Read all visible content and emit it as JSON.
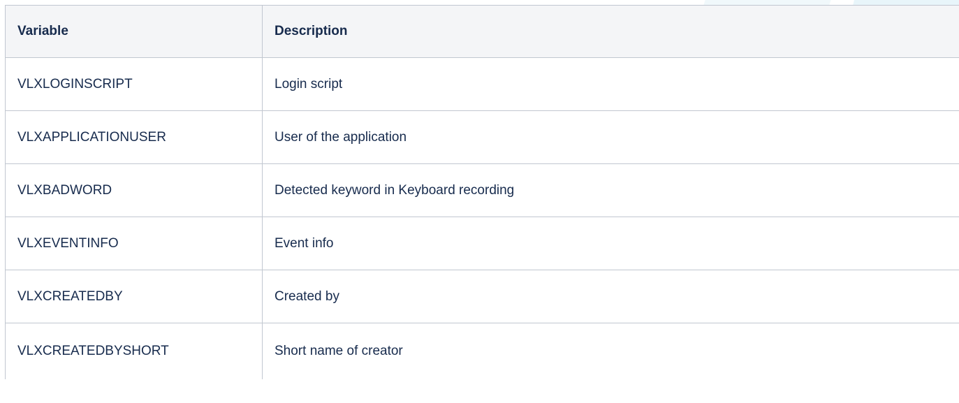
{
  "colors": {
    "header_bg": "#f4f5f7",
    "border": "#c1c7d0",
    "text": "#172b4d"
  },
  "table": {
    "headers": [
      "Variable",
      "Description"
    ],
    "rows": [
      [
        "VLXLOGINSCRIPT",
        "Login script"
      ],
      [
        "VLXAPPLICATIONUSER",
        "User of the application"
      ],
      [
        "VLXBADWORD",
        "Detected keyword in Keyboard recording"
      ],
      [
        "VLXEVENTINFO",
        "Event info"
      ],
      [
        "VLXCREATEDBY",
        "Created by"
      ],
      [
        "VLXCREATEDBYSHORT",
        "Short name of creator"
      ]
    ]
  }
}
